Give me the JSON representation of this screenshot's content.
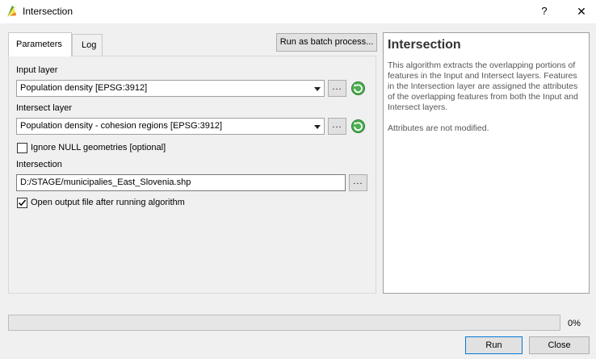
{
  "window": {
    "title": "Intersection",
    "help_label": "?",
    "close_label": "✕"
  },
  "tabs": [
    {
      "label": "Parameters",
      "active": true
    },
    {
      "label": "Log",
      "active": false
    }
  ],
  "batch_button_label": "Run as batch process...",
  "params": {
    "input_layer": {
      "label": "Input layer",
      "value": "Population density [EPSG:3912]",
      "browse_label": "..."
    },
    "intersect_layer": {
      "label": "Intersect layer",
      "value": "Population density - cohesion regions [EPSG:3912]",
      "browse_label": "..."
    },
    "ignore_null": {
      "label": "Ignore NULL geometries [optional]",
      "checked": false
    },
    "intersection": {
      "label": "Intersection",
      "value": "D:/STAGE/municipalies_East_Slovenia.shp",
      "browse_label": "..."
    },
    "open_output": {
      "label": "Open output file after running algorithm",
      "checked": true
    }
  },
  "help": {
    "title": "Intersection",
    "paragraphs": [
      "This algorithm extracts the overlapping portions of features in the Input and Intersect layers. Features in the Intersection layer are assigned the attributes of the overlapping features from both the Input and Intersect layers.",
      "Attributes are not modified."
    ]
  },
  "progress": {
    "value": 0,
    "label": "0%"
  },
  "buttons": {
    "run": "Run",
    "close": "Close"
  },
  "colors": {
    "accent": "#0078d7",
    "iterate_icon": "#3aa53a"
  }
}
